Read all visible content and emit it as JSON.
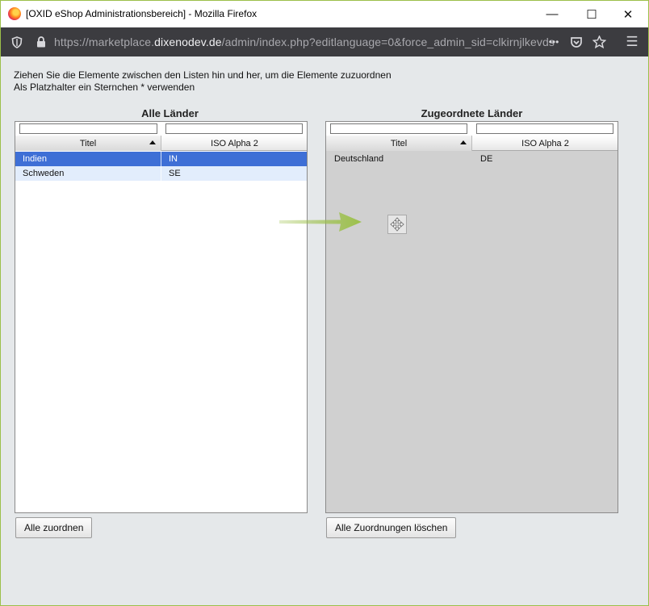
{
  "window": {
    "title": "[OXID eShop Administrationsbereich] - Mozilla Firefox",
    "controls": {
      "minimize": "—",
      "maximize": "☐",
      "close": "✕"
    }
  },
  "urlbar": {
    "url_prefix": "https://marketplace.",
    "url_host": "dixenodev.de",
    "url_suffix": "/admin/index.php?editlanguage=0&force_admin_sid=clkirnjlkevds",
    "more": "•••",
    "menu": "☰"
  },
  "instructions": {
    "line1": "Ziehen Sie die Elemente zwischen den Listen hin und her, um die Elemente zuzuordnen",
    "line2": "Als Platzhalter ein Sternchen * verwenden"
  },
  "left": {
    "title": "Alle Länder",
    "columns": [
      "Titel",
      "ISO Alpha 2"
    ],
    "rows": [
      {
        "title": "Indien",
        "iso": "IN"
      },
      {
        "title": "Schweden",
        "iso": "SE"
      }
    ],
    "button": "Alle zuordnen"
  },
  "right": {
    "title": "Zugeordnete Länder",
    "columns": [
      "Titel",
      "ISO Alpha 2"
    ],
    "rows": [
      {
        "title": "Deutschland",
        "iso": "DE"
      }
    ],
    "button": "Alle Zuordnungen löschen"
  },
  "colors": {
    "selected_row": "#3e6fd6",
    "alt_row": "#e2edfc",
    "assigned_bg": "#d0d0d0",
    "arrow": "#9cc04a"
  },
  "icons": [
    "firefox-icon",
    "shield-icon",
    "lock-icon",
    "pocket-icon",
    "bookmark-star-icon",
    "menu-icon",
    "move-icon",
    "arrow-right-icon"
  ]
}
